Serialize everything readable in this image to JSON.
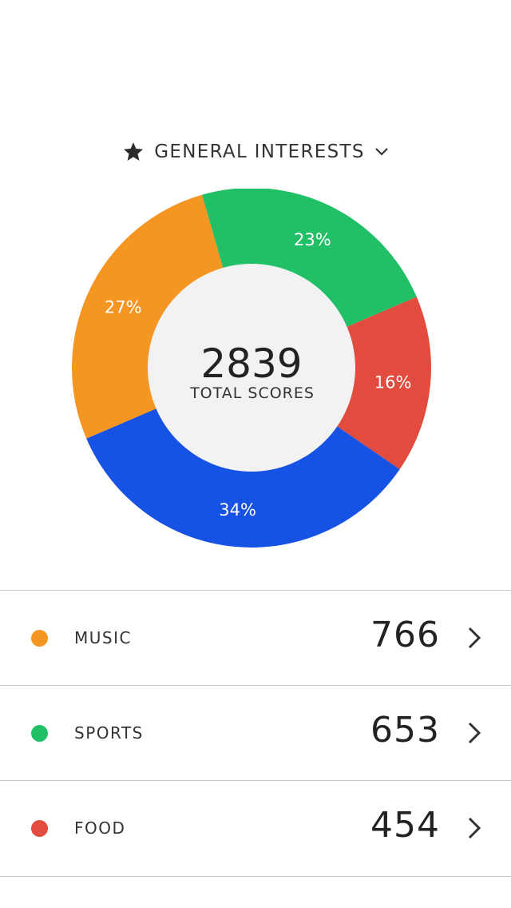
{
  "header": {
    "title": "GENERAL INTERESTS",
    "icon": "star-icon",
    "dropdown_icon": "chevron-down-icon"
  },
  "chart_data": {
    "type": "pie",
    "center_value": "2839",
    "center_label": "TOTAL SCORES",
    "slices": [
      {
        "label": "23%",
        "percent": 23,
        "color": "#22C066"
      },
      {
        "label": "16%",
        "percent": 16,
        "color": "#E14C3E"
      },
      {
        "label": "34%",
        "percent": 34,
        "color": "#1652E3"
      },
      {
        "label": "27%",
        "percent": 27,
        "color": "#F59522"
      }
    ]
  },
  "list": {
    "items": [
      {
        "label": "MUSIC",
        "value": "766",
        "color": "#F59522"
      },
      {
        "label": "SPORTS",
        "value": "653",
        "color": "#22C066"
      },
      {
        "label": "FOOD",
        "value": "454",
        "color": "#E14C3E"
      }
    ]
  }
}
